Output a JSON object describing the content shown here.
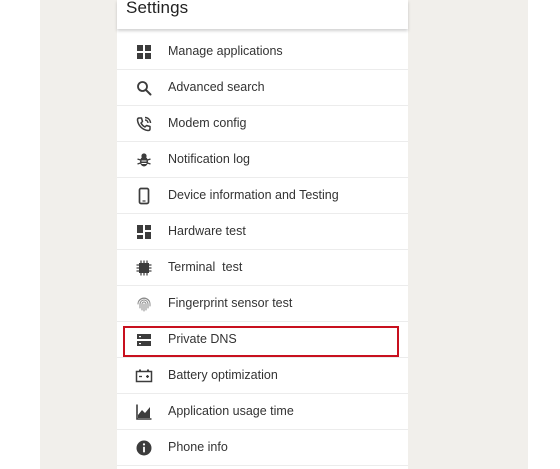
{
  "header": {
    "title": "Settings"
  },
  "items": [
    {
      "label": "Manage applications",
      "icon": "grid-icon"
    },
    {
      "label": "Advanced search",
      "icon": "search-icon"
    },
    {
      "label": "Modem config",
      "icon": "phone-call-icon"
    },
    {
      "label": "Notification log",
      "icon": "bug-icon"
    },
    {
      "label": "Device information and Testing",
      "icon": "smartphone-icon"
    },
    {
      "label": "Hardware test",
      "icon": "dashboard-icon"
    },
    {
      "label": "Terminal  test",
      "icon": "chip-icon"
    },
    {
      "label": "Fingerprint sensor test",
      "icon": "fingerprint-icon"
    },
    {
      "label": "Private DNS",
      "icon": "dns-icon"
    },
    {
      "label": "Battery optimization",
      "icon": "battery-icon"
    },
    {
      "label": "Application usage time",
      "icon": "chart-icon"
    },
    {
      "label": "Phone info",
      "icon": "info-icon"
    }
  ],
  "colors": {
    "highlight_border": "#c8101e",
    "icon": "#3c3c3c",
    "background": "#f1efeb"
  }
}
